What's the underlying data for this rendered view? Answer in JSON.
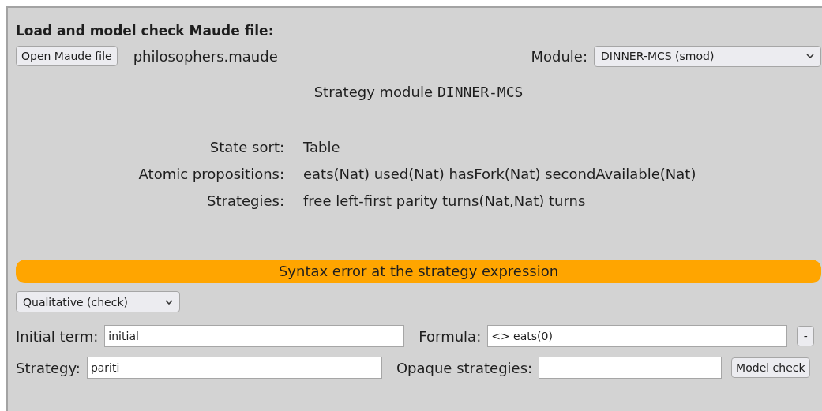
{
  "title": "Load and model check Maude file:",
  "open_button": "Open Maude file",
  "file_name": "philosophers.maude",
  "module": {
    "label": "Module:",
    "value": "DINNER-MCS (smod)"
  },
  "module_info": {
    "prefix": "Strategy module",
    "name": "DINNER-MCS"
  },
  "details": [
    {
      "label": "State sort:",
      "value": "Table"
    },
    {
      "label": "Atomic propositions:",
      "value": "eats(Nat) used(Nat) hasFork(Nat) secondAvailable(Nat)"
    },
    {
      "label": "Strategies:",
      "value": "free left-first parity turns(Nat,Nat) turns"
    }
  ],
  "error": "Syntax error at the strategy expression",
  "mode": "Qualitative (check)",
  "initial_term": {
    "label": "Initial term:",
    "value": "initial"
  },
  "formula": {
    "label": "Formula:",
    "value": "<> eats(0)"
  },
  "formula_button": "-",
  "strategy": {
    "label": "Strategy:",
    "value": "pariti"
  },
  "opaque": {
    "label": "Opaque strategies:"
  },
  "check_button": "Model check"
}
